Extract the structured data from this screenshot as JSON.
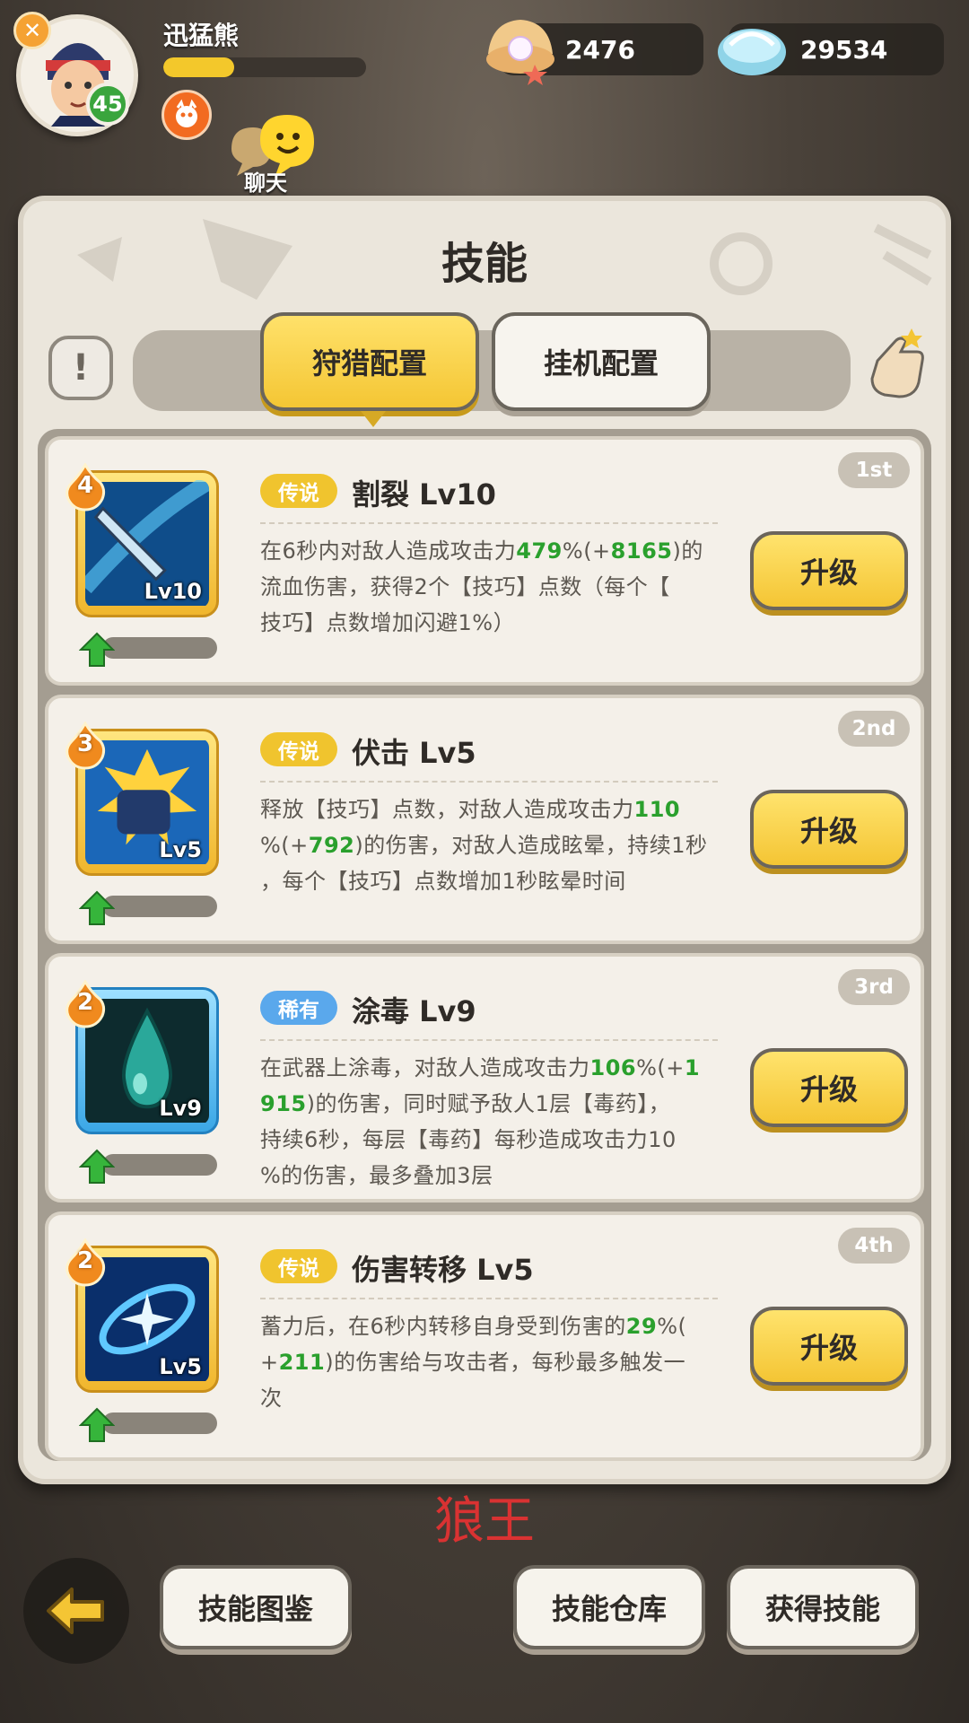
{
  "player": {
    "name": "迅猛熊",
    "level": "45",
    "xp_fraction": 0.35
  },
  "chat": {
    "label": "聊天"
  },
  "currencies": [
    {
      "icon": "pearl-shell-icon",
      "value": "2476"
    },
    {
      "icon": "blue-shell-icon",
      "value": "29534"
    }
  ],
  "panel": {
    "title": "技能",
    "tabs": {
      "active": "狩猎配置",
      "inactive": "挂机配置"
    },
    "info_symbol": "!"
  },
  "skills": [
    {
      "rarity": "传说",
      "rarity_kind": "legend",
      "name": "割裂 Lv10",
      "rank": "1st",
      "stars": "4",
      "icon_level": "Lv10",
      "frame": "gold",
      "desc_parts": [
        {
          "t": "在6秒内对敌人造成攻击力"
        },
        {
          "t": "479",
          "g": true
        },
        {
          "t": "%(+"
        },
        {
          "t": "8165",
          "g": true
        },
        {
          "t": ")的\n流血伤害，获得2个【技巧】点数（每个【\n技巧】点数增加闪避1%）"
        }
      ],
      "button": "升级"
    },
    {
      "rarity": "传说",
      "rarity_kind": "legend",
      "name": "伏击 Lv5",
      "rank": "2nd",
      "stars": "3",
      "icon_level": "Lv5",
      "frame": "gold",
      "desc_parts": [
        {
          "t": "释放【技巧】点数，对敌人造成攻击力"
        },
        {
          "t": "110",
          "g": true
        },
        {
          "t": "\n%(+"
        },
        {
          "t": "792",
          "g": true
        },
        {
          "t": ")的伤害，对敌人造成眩晕，持续1秒\n，每个【技巧】点数增加1秒眩晕时间"
        }
      ],
      "button": "升级"
    },
    {
      "rarity": "稀有",
      "rarity_kind": "rare",
      "name": "涂毒 Lv9",
      "rank": "3rd",
      "stars": "2",
      "icon_level": "Lv9",
      "frame": "blue",
      "desc_parts": [
        {
          "t": "在武器上涂毒，对敌人造成攻击力"
        },
        {
          "t": "106",
          "g": true
        },
        {
          "t": "%(+"
        },
        {
          "t": "1\n915",
          "g": true
        },
        {
          "t": ")的伤害，同时赋予敌人1层【毒药】，\n持续6秒，每层【毒药】每秒造成攻击力10\n%的伤害，最多叠加3层"
        }
      ],
      "button": "升级"
    },
    {
      "rarity": "传说",
      "rarity_kind": "legend",
      "name": "伤害转移 Lv5",
      "rank": "4th",
      "stars": "2",
      "icon_level": "Lv5",
      "frame": "gold",
      "desc_parts": [
        {
          "t": "蓄力后，在6秒内转移自身受到伤害的"
        },
        {
          "t": "29",
          "g": true
        },
        {
          "t": "%(\n+"
        },
        {
          "t": "211",
          "g": true
        },
        {
          "t": ")的伤害给与攻击者，每秒最多触发一\n次"
        }
      ],
      "button": "升级"
    }
  ],
  "watermark": "狼王",
  "bottom": {
    "codex": "技能图鉴",
    "storage": "技能仓库",
    "obtain": "获得技能"
  },
  "colors": {
    "accent_yellow": "#f4c534",
    "highlight_green": "#2aa02d",
    "rare_blue": "#5aa8ec"
  }
}
